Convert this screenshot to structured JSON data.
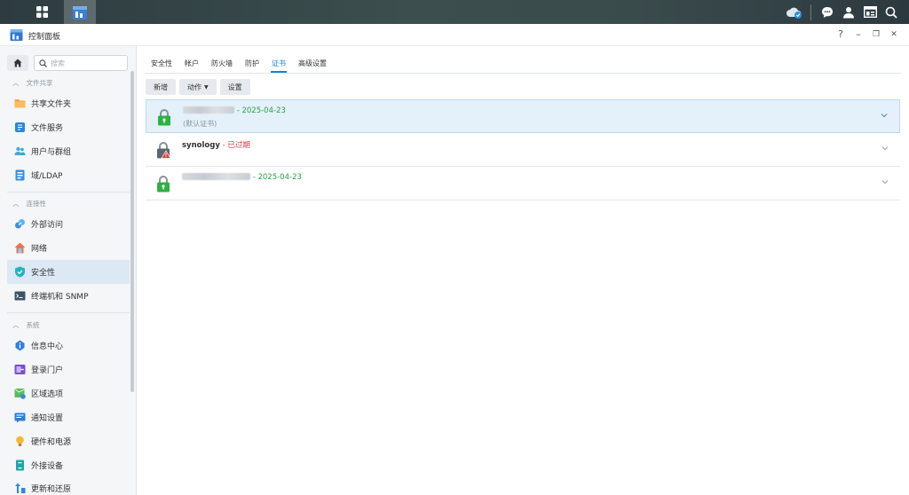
{
  "window": {
    "title": "控制面板",
    "help": "?",
    "minimize": "–",
    "restore": "❐",
    "close": "✕"
  },
  "taskbar": {
    "icons": [
      "apps-grid-icon",
      "control-panel-icon",
      "cloud-sync-icon",
      "chat-icon",
      "user-icon",
      "widgets-icon",
      "search-icon"
    ]
  },
  "sidebar": {
    "search_placeholder": "搜索",
    "groups": [
      {
        "label": "文件共享",
        "items": [
          "共享文件夹",
          "文件服务",
          "用户与群组",
          "域/LDAP"
        ]
      },
      {
        "label": "连接性",
        "items": [
          "外部访问",
          "网络",
          "安全性",
          "终端机和 SNMP"
        ]
      },
      {
        "label": "系统",
        "items": [
          "信息中心",
          "登录门户",
          "区域选项",
          "通知设置",
          "硬件和电源",
          "外接设备",
          "更新和还原"
        ]
      }
    ],
    "active_item": "安全性"
  },
  "tabs": [
    "安全性",
    "帐户",
    "防火墙",
    "防护",
    "证书",
    "高级设置"
  ],
  "active_tab": "证书",
  "toolbar": {
    "add": "新增",
    "action": "动作",
    "settings": "设置"
  },
  "certificates": [
    {
      "name": "",
      "separator": " - ",
      "status": "2025-04-23",
      "status_type": "valid",
      "note": "(默认证书)"
    },
    {
      "name": "synology",
      "separator": " - ",
      "status": "已过期",
      "status_type": "expired",
      "note": ""
    },
    {
      "name": "",
      "separator": " - ",
      "status": "2025-04-23",
      "status_type": "valid",
      "note": ""
    }
  ],
  "colors": {
    "accent": "#0d86d7",
    "valid": "#27a044",
    "expired": "#e0393b",
    "selected_row": "#e4f0fa"
  }
}
